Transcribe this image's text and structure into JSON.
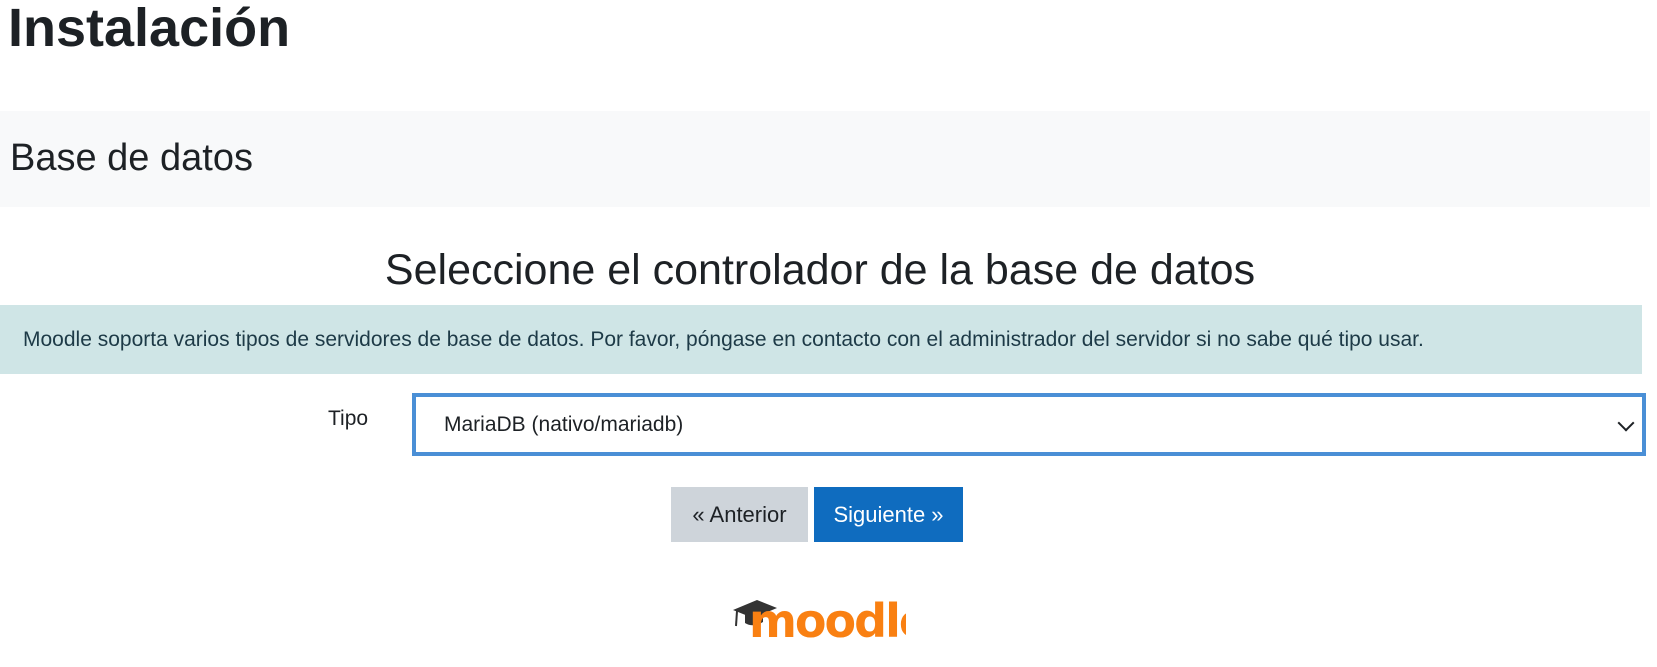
{
  "page": {
    "title": "Instalación",
    "section": "Base de datos",
    "subheading": "Seleccione el controlador de la base de datos"
  },
  "alert": {
    "text": "Moodle soporta varios tipos de servidores de base de datos. Por favor, póngase en contacto con el administrador del servidor si no sabe qué tipo usar."
  },
  "form": {
    "type_label": "Tipo",
    "type_value": "MariaDB (nativo/mariadb)"
  },
  "buttons": {
    "previous": "« Anterior",
    "next": "Siguiente »"
  },
  "footer": {
    "logo_text": "moodle"
  },
  "colors": {
    "primary": "#0f6cbf",
    "logo_orange": "#f98012",
    "alert_bg": "#cfe5e6",
    "focus_border": "#4a8fd6"
  }
}
